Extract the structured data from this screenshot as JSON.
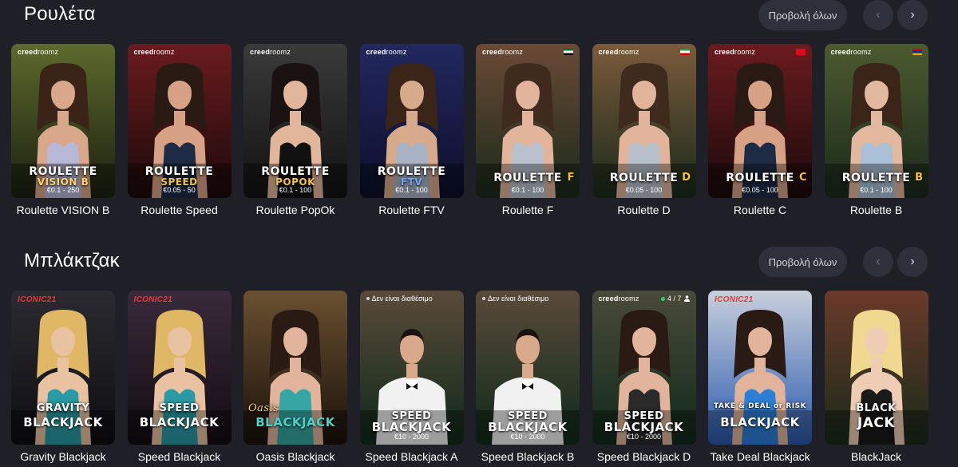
{
  "sections": {
    "roulette": {
      "title": "Ρουλέτα",
      "view_all": "Προβολή όλων",
      "prev_icon": "‹",
      "next_icon": "›",
      "games": [
        {
          "name": "Roulette VISION B",
          "brand_a": "creed",
          "brand_b": "roomz",
          "logo_top": "ROULETTE",
          "logo_bottom": "VISION B",
          "limits": "€0.1 - 250",
          "flag": "",
          "bg": [
            "#5d6a2c",
            "#1a2010"
          ],
          "accent": "#ffd36a",
          "skin": "#d9a78a",
          "dress": "#b7b7d6",
          "hair": "#3a2418"
        },
        {
          "name": "Roulette Speed",
          "brand_a": "creed",
          "brand_b": "roomz",
          "logo_top": "ROULETTE",
          "logo_bottom": "SPEED",
          "limits": "€0.05 - 50",
          "flag": "",
          "bg": [
            "#6b1b1f",
            "#1b0a0b"
          ],
          "accent": "#f4c440",
          "skin": "#d6a185",
          "dress": "#1e2b45",
          "hair": "#2a1a14"
        },
        {
          "name": "Roulette PopOk",
          "brand_a": "creed",
          "brand_b": "roomz",
          "logo_top": "ROULETTE",
          "logo_bottom": "POPOK",
          "limits": "€0.1 - 100",
          "flag": "",
          "bg": [
            "#3b3a3a",
            "#121212"
          ],
          "accent": "#f4c440",
          "skin": "#e2b69b",
          "dress": "#111111",
          "hair": "#1a1210"
        },
        {
          "name": "Roulette FTV",
          "brand_a": "creed",
          "brand_b": "roomz",
          "logo_top": "ROULETTE",
          "logo_bottom": "FTV",
          "limits": "€0.1 - 100",
          "flag": "",
          "bg": [
            "#23285f",
            "#0c0f2a"
          ],
          "accent": "#6fa8ff",
          "skin": "#d8aa8c",
          "dress": "#a9b2c4",
          "hair": "#3b2418"
        },
        {
          "name": "Roulette F",
          "brand_a": "creed",
          "brand_b": "roomz",
          "logo_top": "ROULETTE",
          "logo_bottom": "F",
          "limits": "€0.1 - 100",
          "flag": "ae",
          "bg": [
            "#6a4a36",
            "#1a2a1b"
          ],
          "accent": "#f4c440",
          "skin": "#e1b49b",
          "dress": "#b9c2cc",
          "hair": "#3f2a1e"
        },
        {
          "name": "Roulette D",
          "brand_a": "creed",
          "brand_b": "roomz",
          "logo_top": "ROULETTE",
          "logo_bottom": "D",
          "limits": "€0.05 - 100",
          "flag": "ir",
          "bg": [
            "#7a5a3a",
            "#1a2a1b"
          ],
          "accent": "#f4c440",
          "skin": "#e1b49b",
          "dress": "#b8c0ca",
          "hair": "#3f2a1e"
        },
        {
          "name": "Roulette C",
          "brand_a": "creed",
          "brand_b": "roomz",
          "logo_top": "ROULETTE",
          "logo_bottom": "C",
          "limits": "€0.05 - 100",
          "flag": "tr",
          "bg": [
            "#6b1b1f",
            "#1b0a0b"
          ],
          "accent": "#f4c440",
          "skin": "#d6a185",
          "dress": "#1e2b45",
          "hair": "#2a1a14"
        },
        {
          "name": "Roulette B",
          "brand_a": "creed",
          "brand_b": "roomz",
          "logo_top": "ROULETTE",
          "logo_bottom": "B",
          "limits": "€0.1 - 100",
          "flag": "am",
          "bg": [
            "#4c5a2f",
            "#1a2a1b"
          ],
          "accent": "#f4c440",
          "skin": "#e2b89e",
          "dress": "#a9c0d6",
          "hair": "#3b2418"
        }
      ]
    },
    "blackjack": {
      "title": "Μπλάκτζακ",
      "view_all": "Προβολή όλων",
      "prev_icon": "‹",
      "next_icon": "›",
      "games": [
        {
          "name": "Gravity Blackjack",
          "badge": "ICONIC21",
          "logo_top": "GRAVITY",
          "logo_bottom": "BLACKJACK",
          "limits": "",
          "status": "",
          "seats": "",
          "bg": [
            "#2a2a30",
            "#0e0e12"
          ],
          "skin": "#e9c2a2",
          "dress": "#2a9aa5",
          "hair": "#e0b865"
        },
        {
          "name": "Speed Blackjack",
          "badge": "ICONIC21",
          "logo_top": "SPEED",
          "logo_bottom": "BLACKJACK",
          "limits": "",
          "status": "",
          "seats": "",
          "bg": [
            "#3a2a3a",
            "#120c12"
          ],
          "skin": "#e9c2a2",
          "dress": "#2a9aa5",
          "hair": "#e0b865"
        },
        {
          "name": "Oasis Blackjack",
          "badge": "",
          "logo_top": "Oasis",
          "logo_bottom": "BLACKJACK",
          "limits": "",
          "status": "",
          "seats": "",
          "bg": [
            "#6a5030",
            "#1a120a"
          ],
          "skin": "#e1b49b",
          "dress": "#35a6a3",
          "hair": "#2a1a14"
        },
        {
          "name": "Speed Blackjack A",
          "badge": "",
          "logo_top": "SPEED",
          "logo_bottom": "BLACKJACK",
          "limits": "€10 - 2000",
          "status": "Δεν είναι διαθέσιμο",
          "seats": "",
          "bg": [
            "#5a4a3a",
            "#0f2a1a"
          ],
          "skin": "#d9a98b",
          "dress": "#f1f1f1",
          "hair": "#1a120e"
        },
        {
          "name": "Speed Blackjack B",
          "badge": "",
          "logo_top": "SPEED",
          "logo_bottom": "BLACKJACK",
          "limits": "€10 - 2000",
          "status": "Δεν είναι διαθέσιμο",
          "seats": "",
          "bg": [
            "#5a4a3a",
            "#0f2a1a"
          ],
          "skin": "#d9a98b",
          "dress": "#f1f1f1",
          "hair": "#1a120e"
        },
        {
          "name": "Speed Blackjack D",
          "badge": "",
          "brand_a": "creed",
          "brand_b": "roomz",
          "logo_top": "SPEED",
          "logo_bottom": "BLACKJACK",
          "limits": "€10 - 2000",
          "status": "",
          "seats": "4 / 7",
          "bg": [
            "#4a4a3a",
            "#0f2a1a"
          ],
          "skin": "#e1b49b",
          "dress": "#2a2a2a",
          "hair": "#2a1a14"
        },
        {
          "name": "Take Deal Blackjack",
          "badge": "ICONIC21",
          "logo_top": "TAKE & DEAL or RISK",
          "logo_bottom": "BLACKJACK",
          "limits": "",
          "status": "",
          "seats": "",
          "bg": [
            "#c8cfda",
            "#2a5ab0"
          ],
          "skin": "#e1b49b",
          "dress": "#2d7fd6",
          "hair": "#2a1a14"
        },
        {
          "name": "BlackJack",
          "badge": "",
          "logo_top": "BLACK",
          "logo_bottom": "JACK",
          "limits": "",
          "status": "",
          "seats": "",
          "bg": [
            "#6a3a2a",
            "#1a2a1a"
          ],
          "skin": "#efcdb4",
          "dress": "#1a1a1a",
          "hair": "#f0d890"
        }
      ]
    }
  },
  "icons": {
    "prev": "chevron-left-icon",
    "next": "chevron-right-icon",
    "seat": "person-icon"
  }
}
